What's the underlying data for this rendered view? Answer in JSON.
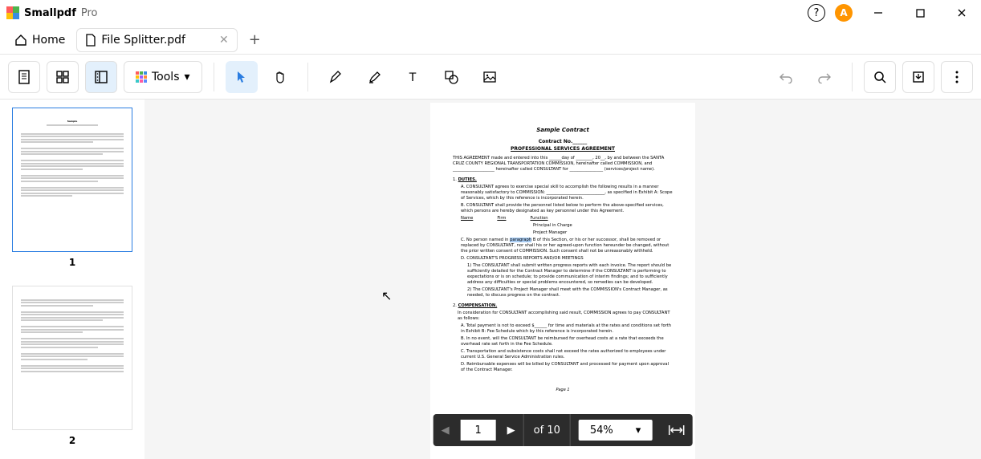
{
  "app": {
    "name": "Smallpdf",
    "pro": "Pro",
    "avatar_initial": "A"
  },
  "tabs": {
    "home_label": "Home",
    "file_label": "File Splitter.pdf"
  },
  "toolbar": {
    "tools_label": "Tools"
  },
  "thumbnails": [
    "1",
    "2"
  ],
  "document": {
    "title": "Sample Contract",
    "contract_no": "Contract No.______",
    "subtitle": "PROFESSIONAL SERVICES AGREEMENT",
    "intro": "THIS AGREEMENT made and entered into this ______day of ________, 20__, by and between the SANTA CRUZ COUNTY REGIONAL TRANSPORTATION COMMISSION, hereinafter called COMMISSION, and ____________________ hereinafter called CONSULTANT for ________________ (services/project name).",
    "s1": {
      "num": "1.",
      "title": "DUTIES."
    },
    "s1a": "A.  CONSULTANT agrees to exercise special skill to accomplish the following results in a manner reasonably satisfactory to COMMISSION: ____________________________, as specified in Exhibit A: Scope of Services, which by this reference is incorporated herein.",
    "s1b": "B.  CONSULTANT shall provide the personnel listed below to perform the above-specified services, which persons are hereby designated as key personnel under this Agreement.",
    "s1b_h1": "Name",
    "s1b_h2": "Firm",
    "s1b_h3": "Function",
    "s1b_r1": "Principal in Charge",
    "s1b_r2": "Project Manager",
    "s1c_pre": "C.  No person named in ",
    "s1c_hl": "paragraph",
    "s1c_post": " B of this Section, or his or her successor, shall be removed or replaced by CONSULTANT, nor shall his or her agreed-upon function hereunder be changed, without the prior written consent of COMMISSION.  Such consent shall not be unreasonably withheld.",
    "s1d": "D.  CONSULTANT'S PROGRESS REPORTS AND/OR MEETINGS",
    "s1d1": "1)  The CONSULTANT shall submit written progress reports with each invoice. The report should be sufficiently detailed for the Contract Manager to determine if the CONSULTANT is performing to expectations or is on schedule; to provide communication of interim findings; and to sufficiently address any difficulties or special problems encountered, so remedies can be developed.",
    "s1d2": "2)  The CONSULTANT's Project Manager shall meet with the COMMISSION's Contract Manager, as needed, to discuss progress on the contract.",
    "s2": {
      "num": "2.",
      "title": "COMPENSATION."
    },
    "s2_intro": "In consideration for CONSULTANT accomplishing said result, COMMISSION agrees to pay CONSULTANT as follows:",
    "s2a": "A.  Total payment is not to exceed $______ for time and materials at the rates and conditions set forth in Exhibit B: Fee Schedule which by this reference is incorporated herein.",
    "s2b": "B.  In no event, will the CONSULTANT be reimbursed for overhead costs at a rate that exceeds the overhead rate set forth in the Fee Schedule.",
    "s2c": "C.  Transportation and subsistence costs shall not exceed the rates authorized to employees under current U.S. General Service Administration rules.",
    "s2d": "D.  Reimbursable expenses will be billed by CONSULTANT and processed for payment upon approval of the Contract Manager.",
    "page_footer": "Page 1"
  },
  "nav": {
    "current_page": "1",
    "total": "of 10",
    "zoom": "54%"
  }
}
